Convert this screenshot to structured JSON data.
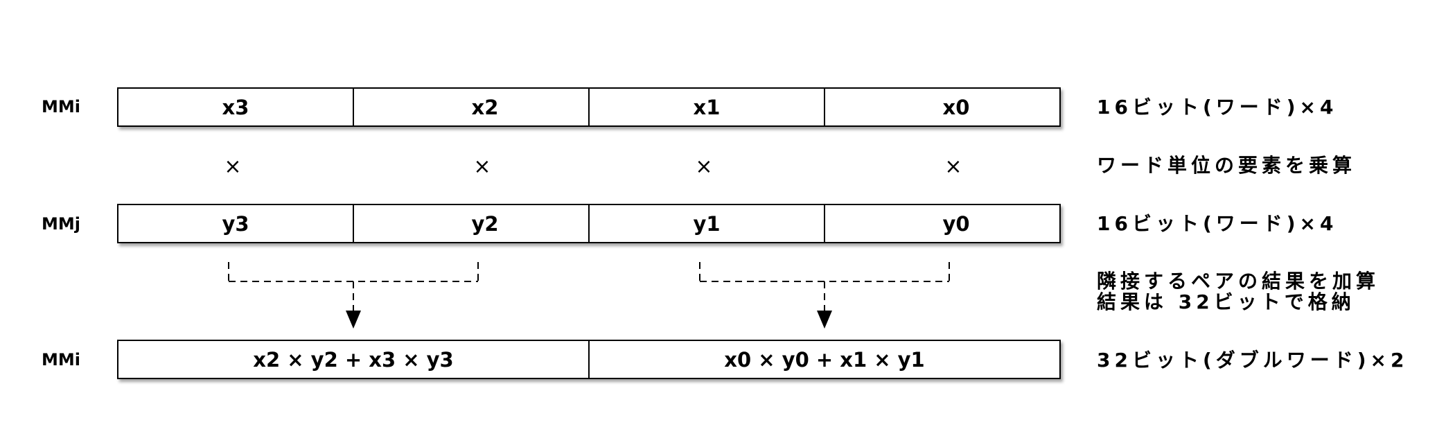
{
  "registers": {
    "mmi_top": "MMi",
    "mmj": "MMj",
    "mmi_result": "MMi"
  },
  "row_x": {
    "cells": [
      "x3",
      "x2",
      "x1",
      "x0"
    ]
  },
  "row_y": {
    "cells": [
      "y3",
      "y2",
      "y1",
      "y0"
    ]
  },
  "multiply_ops": [
    "×",
    "×",
    "×",
    "×"
  ],
  "row_result": {
    "cells": [
      "x2 × y2 + x3 × y3",
      "x0 × y0 + x1 × y1"
    ]
  },
  "notes": {
    "x_format": "16ビット(ワード)×4",
    "multiply": "ワード単位の要素を乗算",
    "y_format": "16ビット(ワード)×4",
    "add_line1": "隣接するペアの結果を加算",
    "add_line2": "結果は 32ビットで格納",
    "result_format": "32ビット(ダブルワード)×2"
  }
}
